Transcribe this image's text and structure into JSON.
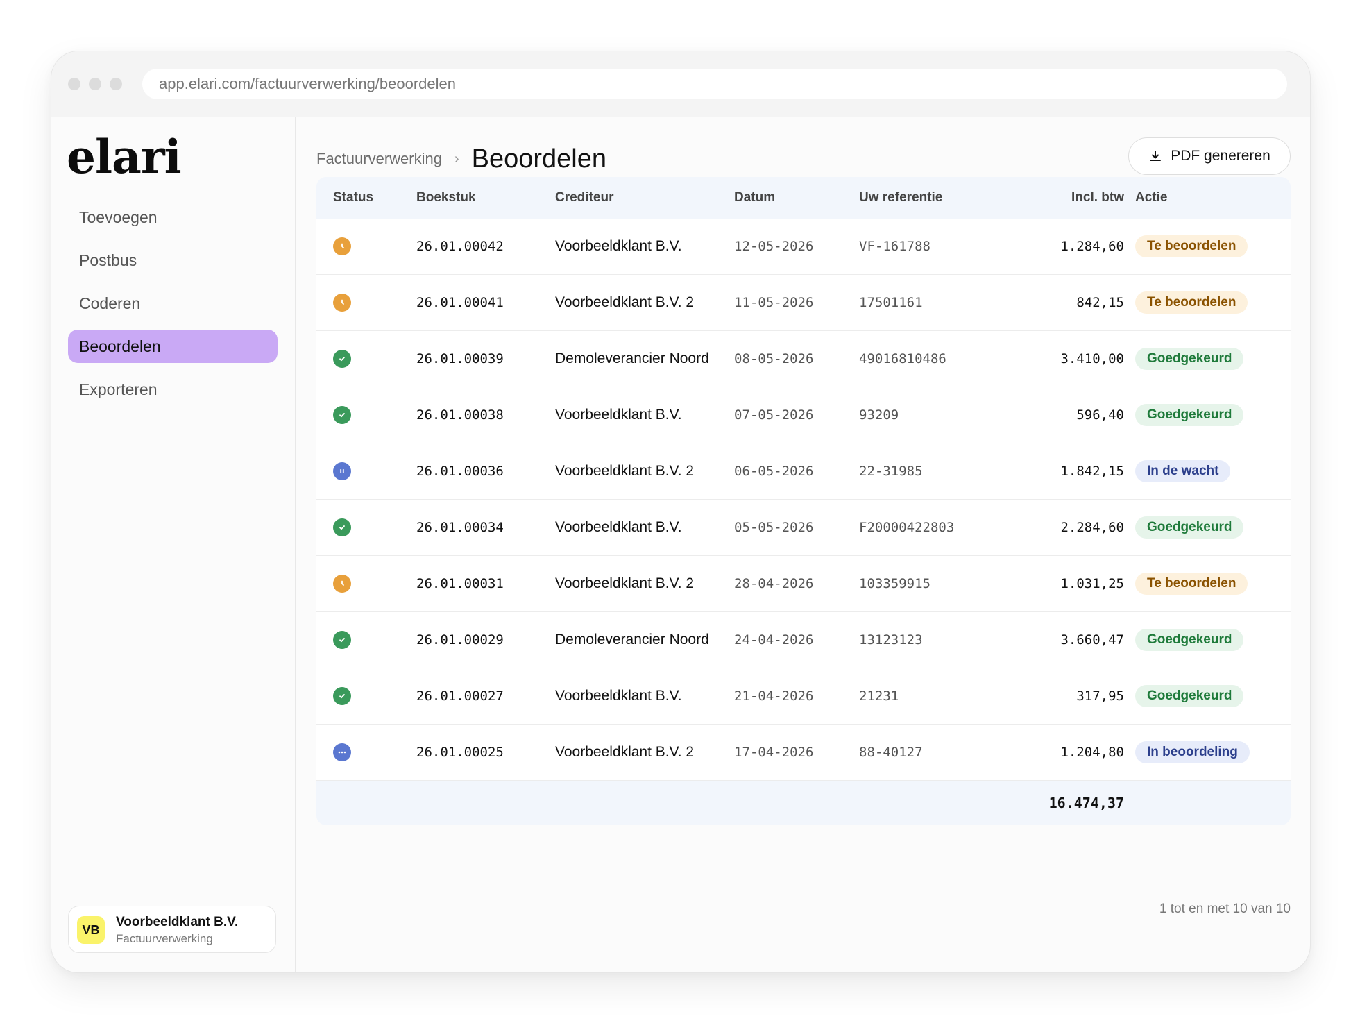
{
  "browser": {
    "url": "app.elari.com/factuurverwerking/beoordelen"
  },
  "sidebar": {
    "logo": "elari",
    "items": [
      {
        "label": "Toevoegen",
        "active": false
      },
      {
        "label": "Postbus",
        "active": false
      },
      {
        "label": "Coderen",
        "active": false
      },
      {
        "label": "Beoordelen",
        "active": true
      },
      {
        "label": "Exporteren",
        "active": false
      }
    ],
    "account": {
      "initials": "VB",
      "name": "Voorbeeldklant B.V.",
      "subtitle": "Factuurverwerking"
    }
  },
  "header": {
    "breadcrumb_parent": "Factuurverwerking",
    "breadcrumb_current": "Beoordelen",
    "pdf_button_label": "PDF genereren",
    "pdf_button_icon": "download-icon"
  },
  "table": {
    "columns": {
      "status": "Status",
      "boekstuk": "Boekstuk",
      "crediteur": "Crediteur",
      "datum": "Datum",
      "referentie": "Uw referentie",
      "bedrag": "Incl. btw",
      "actie": "Actie"
    },
    "rows": [
      {
        "status": "pending",
        "boekstuk": "26.01.00042",
        "crediteur": "Voorbeeldklant B.V.",
        "datum": "12-05-2026",
        "referentie": "VF-161788",
        "bedrag": "1.284,60",
        "actie": "Te beoordelen"
      },
      {
        "status": "pending",
        "boekstuk": "26.01.00041",
        "crediteur": "Voorbeeldklant B.V. 2",
        "datum": "11-05-2026",
        "referentie": "17501161",
        "bedrag": "842,15",
        "actie": "Te beoordelen"
      },
      {
        "status": "approved",
        "boekstuk": "26.01.00039",
        "crediteur": "Demoleverancier Noord",
        "datum": "08-05-2026",
        "referentie": "49016810486",
        "bedrag": "3.410,00",
        "actie": "Goedgekeurd"
      },
      {
        "status": "approved",
        "boekstuk": "26.01.00038",
        "crediteur": "Voorbeeldklant B.V.",
        "datum": "07-05-2026",
        "referentie": "93209",
        "bedrag": "596,40",
        "actie": "Goedgekeurd"
      },
      {
        "status": "paused",
        "boekstuk": "26.01.00036",
        "crediteur": "Voorbeeldklant B.V. 2",
        "datum": "06-05-2026",
        "referentie": "22-31985",
        "bedrag": "1.842,15",
        "actie": "In de wacht"
      },
      {
        "status": "approved",
        "boekstuk": "26.01.00034",
        "crediteur": "Voorbeeldklant B.V.",
        "datum": "05-05-2026",
        "referentie": "F20000422803",
        "bedrag": "2.284,60",
        "actie": "Goedgekeurd"
      },
      {
        "status": "pending",
        "boekstuk": "26.01.00031",
        "crediteur": "Voorbeeldklant B.V. 2",
        "datum": "28-04-2026",
        "referentie": "103359915",
        "bedrag": "1.031,25",
        "actie": "Te beoordelen"
      },
      {
        "status": "approved",
        "boekstuk": "26.01.00029",
        "crediteur": "Demoleverancier Noord",
        "datum": "24-04-2026",
        "referentie": "13123123",
        "bedrag": "3.660,47",
        "actie": "Goedgekeurd"
      },
      {
        "status": "approved",
        "boekstuk": "26.01.00027",
        "crediteur": "Voorbeeldklant B.V.",
        "datum": "21-04-2026",
        "referentie": "21231",
        "bedrag": "317,95",
        "actie": "Goedgekeurd"
      },
      {
        "status": "review",
        "boekstuk": "26.01.00025",
        "crediteur": "Voorbeeldklant B.V. 2",
        "datum": "17-04-2026",
        "referentie": "88-40127",
        "bedrag": "1.204,80",
        "actie": "In beoordeling"
      }
    ],
    "total": "16.474,37"
  },
  "pagination": {
    "text": "1 tot en met 10 van 10"
  },
  "colors": {
    "accent_nav": "#c9a9f5",
    "pending": "#e8a03b",
    "approved": "#3a9a5b",
    "info": "#5a77d0"
  }
}
